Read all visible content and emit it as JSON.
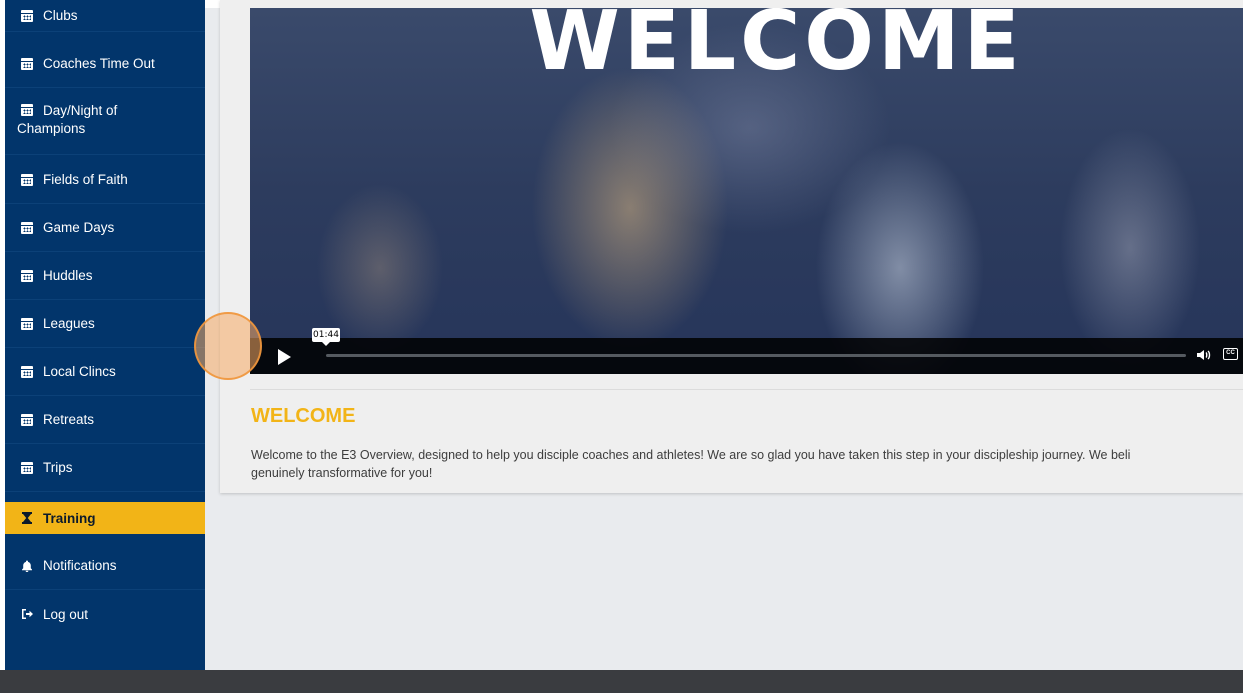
{
  "sidebar": {
    "items": [
      {
        "label": "Clubs",
        "icon": "calendar-icon"
      },
      {
        "label": "Coaches Time Out",
        "icon": "calendar-icon"
      },
      {
        "label": "Day/Night of",
        "label2": "Champions",
        "icon": "calendar-icon"
      },
      {
        "label": "Fields of Faith",
        "icon": "calendar-icon"
      },
      {
        "label": "Game Days",
        "icon": "calendar-icon"
      },
      {
        "label": "Huddles",
        "icon": "calendar-icon"
      },
      {
        "label": "Leagues",
        "icon": "calendar-icon"
      },
      {
        "label": "Local Clincs",
        "icon": "calendar-icon"
      },
      {
        "label": "Retreats",
        "icon": "calendar-icon"
      },
      {
        "label": "Trips",
        "icon": "calendar-icon"
      },
      {
        "label": "Training",
        "icon": "hourglass-icon",
        "active": true
      },
      {
        "label": "Notifications",
        "icon": "bell-icon"
      },
      {
        "label": "Log out",
        "icon": "sign-out-icon"
      }
    ]
  },
  "video": {
    "title_overlay": "WELCOME",
    "hover_time": "01:44",
    "cc_label": "CC"
  },
  "content": {
    "heading": "WELCOME",
    "body": "Welcome to the E3 Overview, designed to help you disciple coaches and athletes! We are so glad you have taken this step in your discipleship journey. We beli genuinely transformative for you!",
    "body_line1": "Welcome to the E3 Overview, designed to help you disciple coaches and athletes! We are so glad you have taken this step in your discipleship journey. We beli",
    "body_line2": "genuinely transformative for you!"
  },
  "colors": {
    "sidebar_bg": "#02356b",
    "accent": "#f2b417",
    "footer": "#3a3c40"
  }
}
